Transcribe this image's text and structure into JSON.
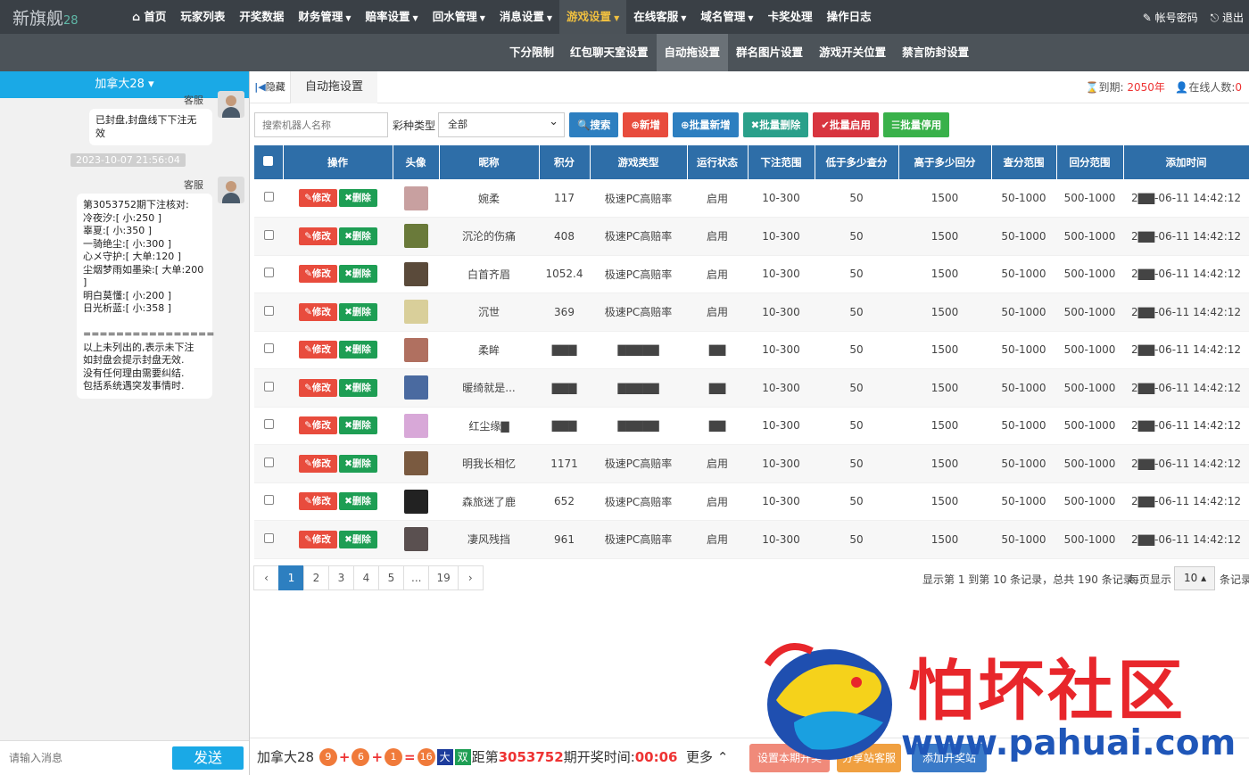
{
  "brand": {
    "name": "新旗舰",
    "suffix": "28"
  },
  "nav": {
    "items": [
      {
        "label": "首页",
        "icon": "home-icon",
        "caret": false
      },
      {
        "label": "玩家列表",
        "caret": false
      },
      {
        "label": "开奖数据",
        "caret": false
      },
      {
        "label": "财务管理",
        "caret": true
      },
      {
        "label": "赔率设置",
        "caret": true
      },
      {
        "label": "回水管理",
        "caret": true
      },
      {
        "label": "消息设置",
        "caret": true
      },
      {
        "label": "游戏设置",
        "caret": true,
        "active": true
      },
      {
        "label": "在线客服",
        "caret": true
      },
      {
        "label": "域名管理",
        "caret": true
      },
      {
        "label": "卡奖处理",
        "caret": false
      },
      {
        "label": "操作日志",
        "caret": false
      }
    ],
    "account": "帐号密码",
    "logout": "退出"
  },
  "subnav": {
    "items": [
      {
        "label": "下分限制"
      },
      {
        "label": "红包聊天室设置"
      },
      {
        "label": "自动拖设置",
        "active": true
      },
      {
        "label": "群名图片设置"
      },
      {
        "label": "游戏开关位置"
      },
      {
        "label": "禁言防封设置"
      }
    ]
  },
  "chat": {
    "room": "加拿大28",
    "sender1": "客服",
    "msg1": "已封盘,封盘线下下注无效",
    "timestamp": "2023-10-07 21:56:04",
    "sender2": "客服",
    "msg2": "第3053752期下注核对:\n冷夜汐:[ 小:250 ]\n辜夏:[ 小:350 ]\n一骑绝尘:[ 小:300 ]\n心メ守护:[ 大单:120 ]\n尘烟梦雨如墨染:[ 大单:200 ]\n明白莫懂:[ 小:200 ]\n日光析蓝:[ 小:358 ]\n\n================\n以上未列出的,表示未下注\n如封盘会提示封盘无效.\n没有任何理由需要纠结.\n包括系统遇突发事情时.",
    "input_placeholder": "请输入消息",
    "send_label": "发送"
  },
  "tabbar": {
    "hide_label": "隐藏",
    "tab": "自动拖设置",
    "expire_label": "到期:",
    "expire_value": "2050年",
    "online_label": "在线人数:",
    "online_value": "0"
  },
  "toolbar": {
    "search_placeholder": "搜索机器人名称",
    "type_label": "彩种类型",
    "type_value": "全部",
    "search": "搜索",
    "add": "新增",
    "batch_add": "批量新增",
    "batch_delete": "批量删除",
    "batch_enable": "批量启用",
    "batch_disable": "批量停用"
  },
  "table": {
    "headers": [
      "操作",
      "头像",
      "昵称",
      "积分",
      "游戏类型",
      "运行状态",
      "下注范围",
      "低于多少查分",
      "高于多少回分",
      "查分范围",
      "回分范围",
      "添加时间"
    ],
    "edit_label": "修改",
    "delete_label": "删除",
    "rows": [
      {
        "nick": "婉柔",
        "score": "117",
        "game": "极速PC高赔率",
        "status": "启用",
        "bet": "10-300",
        "low": "50",
        "high": "1500",
        "check": "50-1000",
        "back": "500-1000",
        "time": "2▇▇-06-11 14:42:12",
        "color": "#c8a0a0"
      },
      {
        "nick": "沉沦的伤痛",
        "score": "408",
        "game": "极速PC高赔率",
        "status": "启用",
        "bet": "10-300",
        "low": "50",
        "high": "1500",
        "check": "50-1000",
        "back": "500-1000",
        "time": "2▇▇-06-11 14:42:12",
        "color": "#6a7a3a"
      },
      {
        "nick": "白首齐眉",
        "score": "1052.4",
        "game": "极速PC高赔率",
        "status": "启用",
        "bet": "10-300",
        "low": "50",
        "high": "1500",
        "check": "50-1000",
        "back": "500-1000",
        "time": "2▇▇-06-11 14:42:12",
        "color": "#5a4a3a"
      },
      {
        "nick": "沉世",
        "score": "369",
        "game": "极速PC高赔率",
        "status": "启用",
        "bet": "10-300",
        "low": "50",
        "high": "1500",
        "check": "50-1000",
        "back": "500-1000",
        "time": "2▇▇-06-11 14:42:12",
        "color": "#d9cf9a"
      },
      {
        "nick": "柔眸",
        "score": "▇▇▇",
        "game": "▇▇▇▇▇",
        "status": "▇▇",
        "bet": "10-300",
        "low": "50",
        "high": "1500",
        "check": "50-1000",
        "back": "500-1000",
        "time": "2▇▇-06-11 14:42:12",
        "color": "#b07060"
      },
      {
        "nick": "暖绮就是...",
        "score": "▇▇▇",
        "game": "▇▇▇▇▇",
        "status": "▇▇",
        "bet": "10-300",
        "low": "50",
        "high": "1500",
        "check": "50-1000",
        "back": "500-1000",
        "time": "2▇▇-06-11 14:42:12",
        "color": "#4a6aa0"
      },
      {
        "nick": "红尘缘▇",
        "score": "▇▇▇",
        "game": "▇▇▇▇▇",
        "status": "▇▇",
        "bet": "10-300",
        "low": "50",
        "high": "1500",
        "check": "50-1000",
        "back": "500-1000",
        "time": "2▇▇-06-11 14:42:12",
        "color": "#d8a8d8"
      },
      {
        "nick": "明我长相忆",
        "score": "1171",
        "game": "极速PC高赔率",
        "status": "启用",
        "bet": "10-300",
        "low": "50",
        "high": "1500",
        "check": "50-1000",
        "back": "500-1000",
        "time": "2▇▇-06-11 14:42:12",
        "color": "#7a5a40"
      },
      {
        "nick": "森旅迷了鹿",
        "score": "652",
        "game": "极速PC高赔率",
        "status": "启用",
        "bet": "10-300",
        "low": "50",
        "high": "1500",
        "check": "50-1000",
        "back": "500-1000",
        "time": "2▇▇-06-11 14:42:12",
        "color": "#222222"
      },
      {
        "nick": "凄风残挡",
        "score": "961",
        "game": "极速PC高赔率",
        "status": "启用",
        "bet": "10-300",
        "low": "50",
        "high": "1500",
        "check": "50-1000",
        "back": "500-1000",
        "time": "2▇▇-06-11 14:42:12",
        "color": "#5a5050"
      }
    ]
  },
  "pager": {
    "prev": "‹",
    "pages": [
      "1",
      "2",
      "3",
      "4",
      "5",
      "...",
      "19"
    ],
    "next": "›",
    "info": "显示第 1 到第 10 条记录，总共 190 条记录",
    "per_page_label": "每页显示",
    "per_page": "10",
    "tail": "条记录"
  },
  "bottom": {
    "lottery": "加拿大28",
    "balls": [
      "9",
      "6",
      "1",
      "16"
    ],
    "ops": [
      "+",
      "+",
      "="
    ],
    "big": "大",
    "double": "双",
    "dist": "距第",
    "issue": "3053752",
    "draw_label": "期开奖时间:",
    "countdown": "00:06",
    "more": "更多",
    "btn1": "设置本期开奖",
    "btn2": "分享站客服",
    "btn3": "添加开奖站"
  },
  "watermark": {
    "title": "怕坏社区",
    "url": "www.pahuai.com"
  }
}
